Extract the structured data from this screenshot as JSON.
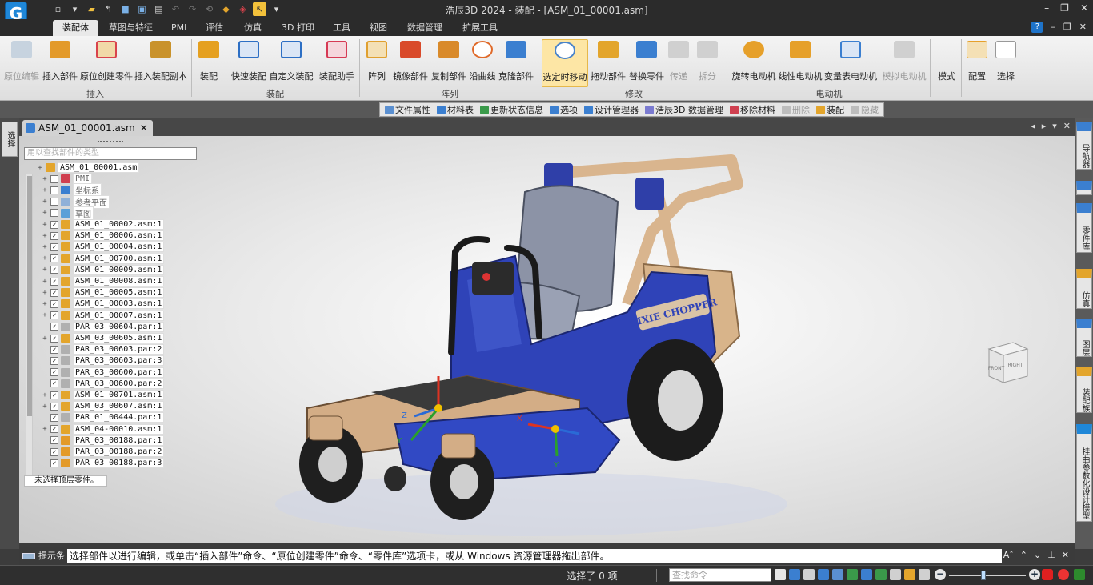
{
  "app": {
    "title": "浩辰3D 2024 - 装配 - [ASM_01_00001.asm]",
    "logo_letter": "G"
  },
  "window_controls": [
    "–",
    "❐",
    "✕"
  ],
  "tabs": [
    {
      "label": "装配体",
      "active": true
    },
    {
      "label": "草图与特征"
    },
    {
      "label": "PMI"
    },
    {
      "label": "评估"
    },
    {
      "label": "仿真"
    },
    {
      "label": "3D 打印"
    },
    {
      "label": "工具"
    },
    {
      "label": "视图"
    },
    {
      "label": "数据管理"
    },
    {
      "label": "扩展工具"
    }
  ],
  "ribbon": {
    "buttons": [
      {
        "label": "原位编辑",
        "disabled": true,
        "color": "#9ab0c8"
      },
      {
        "label": "插入部件",
        "color": "#e39a2a"
      },
      {
        "label": "原位创建零件",
        "color": "#d9434c"
      },
      {
        "label": "插入装配副本",
        "color": "#c9922b"
      },
      {
        "label": "装配",
        "color": "#e5a020"
      },
      {
        "label": "快速装配",
        "color": "#2d6fc4"
      },
      {
        "label": "自定义装配",
        "color": "#2d6fc4"
      },
      {
        "label": "装配助手",
        "color": "#d63a54"
      },
      {
        "label": "阵列",
        "color": "#e0a030"
      },
      {
        "label": "镜像部件",
        "color": "#d94a2a"
      },
      {
        "label": "复制部件",
        "color": "#d98a2a"
      },
      {
        "label": "沿曲线",
        "color": "#e06a2a"
      },
      {
        "label": "克隆部件",
        "color": "#3b7fd0"
      },
      {
        "label": "选定时移动",
        "selected": true,
        "color": "#4a84c9"
      },
      {
        "label": "拖动部件",
        "color": "#e3a52c"
      },
      {
        "label": "替换零件",
        "color": "#3b7fd0"
      },
      {
        "label": "传递",
        "disabled": true,
        "color": "#a0a0a0"
      },
      {
        "label": "拆分",
        "disabled": true,
        "color": "#a0a0a0"
      },
      {
        "label": "旋转电动机",
        "color": "#e6a02a"
      },
      {
        "label": "线性电动机",
        "color": "#e6a02a"
      },
      {
        "label": "变量表电动机",
        "color": "#3b7fd0"
      },
      {
        "label": "模拟电动机",
        "disabled": true,
        "color": "#a0a0a0"
      },
      {
        "label": "模式",
        "color": "#777777"
      },
      {
        "label": "配置",
        "color": "#e6a02a"
      },
      {
        "label": "选择",
        "color": "#777777"
      }
    ],
    "groups": [
      "插入",
      "装配",
      "阵列",
      "修改",
      "电动机"
    ]
  },
  "command_bar": [
    {
      "label": "文件属性",
      "color": "#5a8fd0"
    },
    {
      "label": "材料表",
      "color": "#3b7fd0"
    },
    {
      "label": "更新状态信息",
      "color": "#3a9a4a"
    },
    {
      "label": "选项",
      "color": "#3b7fd0"
    },
    {
      "label": "设计管理器",
      "color": "#3b7fd0"
    },
    {
      "label": "浩辰3D 数据管理",
      "color": "#7a7ad0"
    },
    {
      "label": "移除材料",
      "color": "#d04050"
    },
    {
      "label": "删除",
      "disabled": true,
      "color": "#a0a0a0"
    },
    {
      "label": "装配",
      "color": "#e3a52c"
    },
    {
      "label": "隐藏",
      "disabled": true,
      "color": "#a0a0a0"
    }
  ],
  "left_rail": {
    "label": "选择"
  },
  "document_tab": {
    "label": "ASM_01_00001.asm",
    "close": "✕"
  },
  "tree": {
    "search_placeholder": "用以查找部件的类型",
    "rows": [
      {
        "text": "ASM_01_00001.asm",
        "level": 0,
        "icon": "#e3a52c"
      },
      {
        "text": "PMI",
        "level": 1,
        "icon": "#d04050",
        "dim": true,
        "checked": false
      },
      {
        "text": "坐标系",
        "level": 1,
        "icon": "#3b7fd0",
        "dim": true,
        "checked": false
      },
      {
        "text": "参考平面",
        "level": 1,
        "icon": "#8fb0d8",
        "dim": true,
        "checked": false
      },
      {
        "text": "草图",
        "level": 1,
        "icon": "#5aa0d8",
        "dim": true,
        "checked": false
      },
      {
        "text": "ASM_01_00002.asm:1",
        "level": 1,
        "icon": "#e3a52c",
        "checked": true
      },
      {
        "text": "ASM_01_00006.asm:1",
        "level": 1,
        "icon": "#e3a52c",
        "checked": true
      },
      {
        "text": "ASM_01_00004.asm:1",
        "level": 1,
        "icon": "#e3a52c",
        "checked": true
      },
      {
        "text": "ASM_01_00700.asm:1",
        "level": 1,
        "icon": "#e3a52c",
        "checked": true
      },
      {
        "text": "ASM_01_00009.asm:1",
        "level": 1,
        "icon": "#e3a52c",
        "checked": true
      },
      {
        "text": "ASM_01_00008.asm:1",
        "level": 1,
        "icon": "#e3a52c",
        "checked": true
      },
      {
        "text": "ASM_01_00005.asm:1",
        "level": 1,
        "icon": "#e3a52c",
        "checked": true
      },
      {
        "text": "ASM_01_00003.asm:1",
        "level": 1,
        "icon": "#e3a52c",
        "checked": true
      },
      {
        "text": "ASM_01_00007.asm:1",
        "level": 1,
        "icon": "#e3a52c",
        "checked": true
      },
      {
        "text": "PAR_03_00604.par:1",
        "level": 1,
        "icon": "#b0b0b0",
        "checked": true,
        "leaf": true
      },
      {
        "text": "ASM_03_00605.asm:1",
        "level": 1,
        "icon": "#e3a52c",
        "checked": true
      },
      {
        "text": "PAR_03_00603.par:2",
        "level": 1,
        "icon": "#b0b0b0",
        "checked": true,
        "leaf": true
      },
      {
        "text": "PAR_03_00603.par:3",
        "level": 1,
        "icon": "#b0b0b0",
        "checked": true,
        "leaf": true
      },
      {
        "text": "PAR_03_00600.par:1",
        "level": 1,
        "icon": "#b0b0b0",
        "checked": true,
        "leaf": true
      },
      {
        "text": "PAR_03_00600.par:2",
        "level": 1,
        "icon": "#b0b0b0",
        "checked": true,
        "leaf": true
      },
      {
        "text": "ASM_01_00701.asm:1",
        "level": 1,
        "icon": "#e3a52c",
        "checked": true
      },
      {
        "text": "ASM_03_00607.asm:1",
        "level": 1,
        "icon": "#e3a52c",
        "checked": true
      },
      {
        "text": "PAR_01_00444.par:1",
        "level": 1,
        "icon": "#b0b0b0",
        "checked": true,
        "leaf": true
      },
      {
        "text": "ASM_04-00010.asm:1",
        "level": 1,
        "icon": "#e3a52c",
        "checked": true
      },
      {
        "text": "PAR_03_00188.par:1",
        "level": 1,
        "icon": "#e39a2a",
        "checked": true,
        "leaf": true
      },
      {
        "text": "PAR_03_00188.par:2",
        "level": 1,
        "icon": "#e39a2a",
        "checked": true,
        "leaf": true
      },
      {
        "text": "PAR_03_00188.par:3",
        "level": 1,
        "icon": "#e39a2a",
        "checked": true,
        "leaf": true
      }
    ],
    "status": "未选择顶层零件。"
  },
  "model": {
    "brand_text": "DIXIE CHOPPER",
    "axis_labels": {
      "z": "Z",
      "y1": "Y",
      "y2": "Y",
      "x": "X"
    }
  },
  "viewcube": {
    "front": "FRONT",
    "right": "RIGHT"
  },
  "right_rail": [
    {
      "label": "导航器",
      "color": "#3b7fd0"
    },
    {
      "label": "零件库",
      "color": "#3b7fd0"
    },
    {
      "label": "仿真",
      "color": "#e3a52c"
    },
    {
      "label": "图层",
      "color": "#3b7fd0"
    },
    {
      "label": "装配族",
      "color": "#e3a52c"
    },
    {
      "label": "挂曲参数化设计模型",
      "color": "#1f87d8"
    }
  ],
  "prompt": {
    "label": "提示条",
    "text": "选择部件以进行编辑，或单击“插入部件”命令、“原位创建零件”命令、“零件库”选项卡，或从 Windows 资源管理器拖出部件。"
  },
  "status": {
    "selection": "选择了 0 项",
    "command_search_placeholder": "查找命令"
  }
}
